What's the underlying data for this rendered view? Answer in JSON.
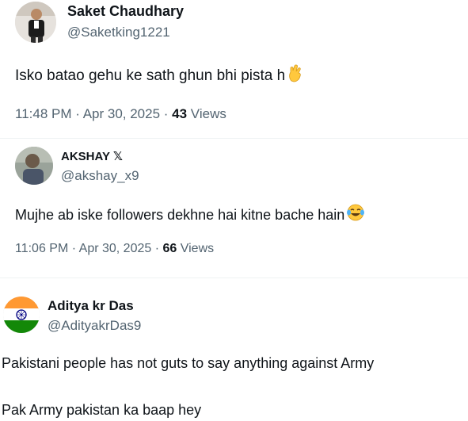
{
  "tweet1": {
    "name": "Saket Chaudhary",
    "handle": "@Saketking1221",
    "text": "Isko batao gehu ke sath ghun bhi pista h",
    "emoji": "crossed-fingers-icon",
    "time": "11:48 PM",
    "sep1": " · ",
    "date": "Apr 30, 2025",
    "sep2": " · ",
    "views_count": "43",
    "views_label": " Views"
  },
  "tweet2": {
    "name": "AKSHAY",
    "name_suffix": "𝕏",
    "handle": "@akshay_x9",
    "text": "Mujhe ab iske followers dekhne hai kitne bache hain",
    "emoji": "tears-of-joy-icon",
    "time": "11:06 PM",
    "sep1": " · ",
    "date": "Apr 30, 2025",
    "sep2": " · ",
    "views_count": "66",
    "views_label": " Views"
  },
  "tweet3": {
    "name": "Aditya kr Das",
    "handle": "@AdityakrDas9",
    "line1": "Pakistani people has not guts to say anything against Army",
    "line2": "Pak Army pakistan ka baap hey",
    "avatar_icon": "india-flag-icon"
  },
  "colors": {
    "text": "#0f1419",
    "secondary": "#536471",
    "divider": "#eff3f4",
    "saffron": "#ff9933",
    "green": "#138808",
    "chakra": "#000080",
    "emoji_yellow": "#ffc83d"
  }
}
